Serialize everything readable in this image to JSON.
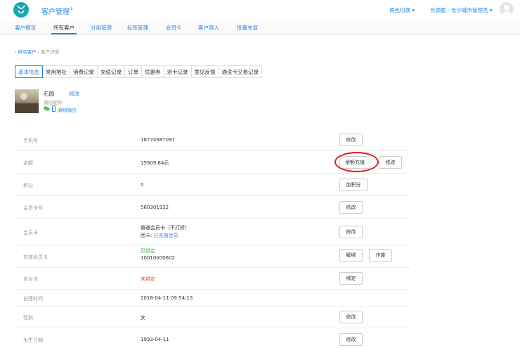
{
  "header": {
    "title": "客户管理",
    "title_arrow": "›",
    "role_switch": "角色切换 ▾",
    "user": "长颈鹿 - 长沙城市管理员 ▾"
  },
  "nav": {
    "items": [
      "客户概览",
      "所有客户",
      "分组管理",
      "标签管理",
      "会员卡",
      "客户导入",
      "批量充值"
    ],
    "active": "所有客户"
  },
  "breadcrumb": {
    "back": "‹ 所有客户",
    "sep": "/",
    "current": "客户详情"
  },
  "tabs": [
    "基本信息",
    "常用地址",
    "消费记录",
    "充值记录",
    "订单",
    "优惠券",
    "退卡记录",
    "意见反馈",
    "通洗卡交易记录"
  ],
  "profile": {
    "name": "石园",
    "edit": "修改",
    "nickname_label": "微信昵称:",
    "unbind_wechat": "解绑微信"
  },
  "details": {
    "phone": {
      "label": "手机号",
      "value": "18774987097",
      "btn": "修改"
    },
    "balance": {
      "label": "余额",
      "value": "15909.84元",
      "btn_recharge": "余额充值",
      "btn_edit": "修改"
    },
    "points": {
      "label": "积分",
      "value": "0",
      "btn": "加积分"
    },
    "card_no": {
      "label": "会员卡号",
      "value": "560301932",
      "btn": "修改"
    },
    "member_card": {
      "label": "会员卡",
      "value": "普通会员卡（不打折）",
      "group_prefix": "团卡:",
      "group_value": "已充值会员",
      "btn": "修改"
    },
    "physical_card": {
      "label": "实体会员卡",
      "status": "已绑定",
      "value": "10010000602",
      "btn_unbind": "解绑",
      "btn_void": "作废"
    },
    "prepaid_card": {
      "label": "优付卡",
      "value": "未绑定",
      "btn": "绑定"
    },
    "created": {
      "label": "创建时间",
      "value": "2018-04-11 09:54:13"
    },
    "gender": {
      "label": "性别",
      "value": "女",
      "btn": "修改"
    },
    "birthday": {
      "label": "出生日期",
      "value": "1993-04-11",
      "btn": "修改"
    }
  },
  "colors": {
    "accent": "#2a86e3",
    "brand": "#1aa6b0",
    "danger": "#e54848",
    "success": "#3bb54a",
    "highlight_ring": "#e01b1b"
  }
}
